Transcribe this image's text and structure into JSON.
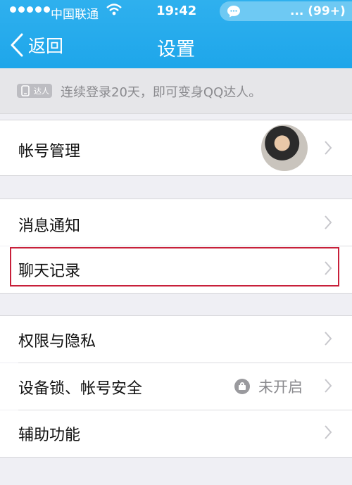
{
  "status": {
    "carrier": "中国联通",
    "time": "19:42",
    "badge": "... (99+)"
  },
  "nav": {
    "back_label": "返回",
    "title": "设置"
  },
  "tip": {
    "badge": "达人",
    "text": "连续登录20天，即可变身QQ达人。"
  },
  "rows": {
    "account": "帐号管理",
    "notifications": "消息通知",
    "chat_history": "聊天记录",
    "privacy": "权限与隐私",
    "device_lock": "设备锁、帐号安全",
    "device_lock_value": "未开启",
    "accessibility": "辅助功能"
  },
  "icons": [
    "signal-dots-icon",
    "wifi-icon",
    "message-icon",
    "back-chevron-icon",
    "phone-icon",
    "avatar",
    "chevron-right-icon",
    "lock-icon"
  ],
  "colors": {
    "header": "#1ea6ea",
    "background": "#efeff4",
    "highlight": "#c8203a"
  }
}
